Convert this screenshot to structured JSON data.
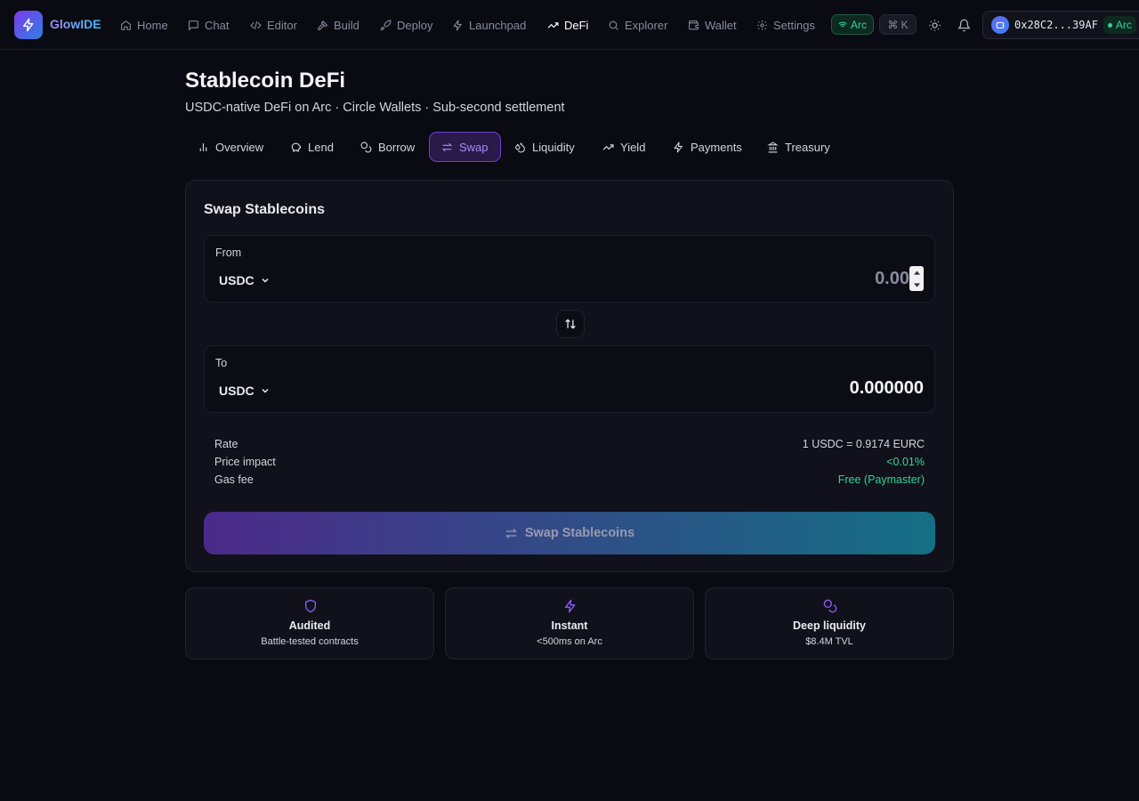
{
  "app": {
    "brand": "GlowIDE"
  },
  "nav": {
    "items": [
      {
        "label": "Home",
        "icon": "home-icon"
      },
      {
        "label": "Chat",
        "icon": "chat-icon"
      },
      {
        "label": "Editor",
        "icon": "code-icon"
      },
      {
        "label": "Build",
        "icon": "hammer-icon"
      },
      {
        "label": "Deploy",
        "icon": "rocket-icon"
      },
      {
        "label": "Launchpad",
        "icon": "zap-icon"
      },
      {
        "label": "DeFi",
        "icon": "trending-up-icon",
        "active": true
      },
      {
        "label": "Explorer",
        "icon": "search-icon"
      },
      {
        "label": "Wallet",
        "icon": "wallet-icon"
      },
      {
        "label": "Settings",
        "icon": "gear-icon"
      }
    ],
    "network_pill": "Arc",
    "shortcut": "⌘ K",
    "wallet_address": "0x28C2...39AF",
    "wallet_network": "Arc"
  },
  "header": {
    "title": "Stablecoin DeFi",
    "subtitle": "USDC-native DeFi on Arc · Circle Wallets · Sub-second settlement"
  },
  "tabs": [
    {
      "label": "Overview",
      "icon": "bar-chart-icon"
    },
    {
      "label": "Lend",
      "icon": "piggy-bank-icon"
    },
    {
      "label": "Borrow",
      "icon": "coins-icon"
    },
    {
      "label": "Swap",
      "icon": "swap-icon",
      "active": true
    },
    {
      "label": "Liquidity",
      "icon": "droplets-icon"
    },
    {
      "label": "Yield",
      "icon": "trending-up-icon"
    },
    {
      "label": "Payments",
      "icon": "zap-icon"
    },
    {
      "label": "Treasury",
      "icon": "landmark-icon"
    }
  ],
  "swap": {
    "title": "Swap Stablecoins",
    "from": {
      "label": "From",
      "token": "USDC",
      "placeholder": "0.00"
    },
    "to": {
      "label": "To",
      "token": "USDC",
      "amount": "0.000000"
    },
    "details": [
      {
        "key": "Rate",
        "value": "1 USDC = 0.9174 EURC",
        "accent": false
      },
      {
        "key": "Price impact",
        "value": "<0.01%",
        "accent": true
      },
      {
        "key": "Gas fee",
        "value": "Free (Paymaster)",
        "accent": true
      }
    ],
    "button_label": "Swap Stablecoins"
  },
  "features": [
    {
      "title": "Audited",
      "desc": "Battle-tested contracts",
      "icon": "shield-icon"
    },
    {
      "title": "Instant",
      "desc": "<500ms on Arc",
      "icon": "zap-icon"
    },
    {
      "title": "Deep liquidity",
      "desc": "$8.4M TVL",
      "icon": "coins-icon"
    }
  ],
  "colors": {
    "accent": "#7c3aed",
    "success": "#34d399",
    "background": "#0a0a12"
  }
}
